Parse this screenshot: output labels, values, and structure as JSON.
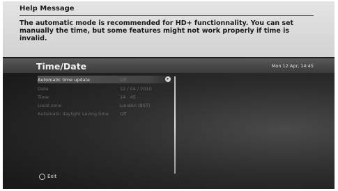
{
  "help": {
    "title": "Help Message",
    "line1": "The automatic mode is recommended for HD+ functionnality. You can set",
    "line2": "manually the time, but some features might not work properly if time is",
    "line3": "invalid."
  },
  "header": {
    "title": "Time/Date",
    "clock": "Mon 12 Apr, 14:45"
  },
  "settings": [
    {
      "label": "Automatic time update",
      "value": "Off"
    },
    {
      "label": "Date",
      "value": "12 / 04 / 2010"
    },
    {
      "label": "Time",
      "value": "14 : 45"
    },
    {
      "label": "Local zone",
      "value": "London (BST)"
    },
    {
      "label": "Automatic daylight saving time",
      "value": "Off"
    }
  ],
  "footer": {
    "exit_label": "Exit"
  },
  "icons": {
    "right_arrow": "right-arrow-icon",
    "exit_button": "exit-button-icon"
  }
}
